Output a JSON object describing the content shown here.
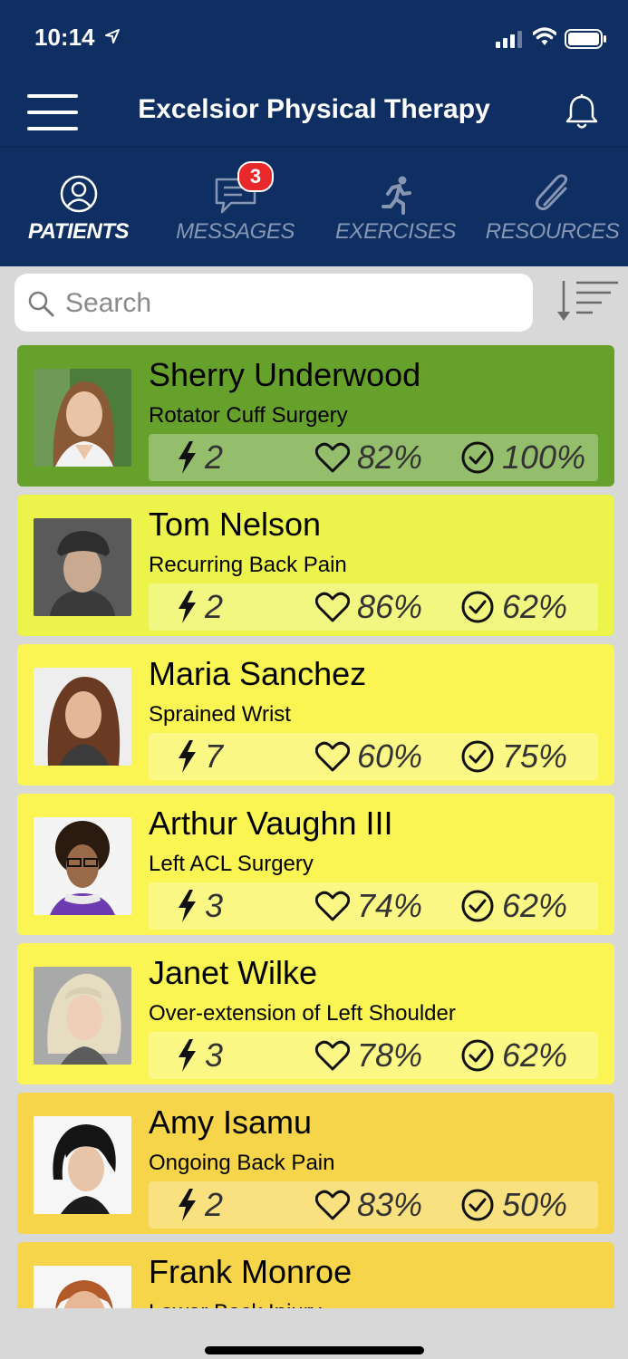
{
  "status_bar": {
    "time": "10:14"
  },
  "header": {
    "title": "Excelsior Physical Therapy"
  },
  "tabs": [
    {
      "label": "PATIENTS",
      "icon": "person-circle-icon",
      "active": true
    },
    {
      "label": "MESSAGES",
      "icon": "chat-bubble-icon",
      "active": false,
      "badge": "3"
    },
    {
      "label": "EXERCISES",
      "icon": "running-person-icon",
      "active": false
    },
    {
      "label": "RESOURCES",
      "icon": "paperclip-icon",
      "active": false
    }
  ],
  "search": {
    "placeholder": "Search",
    "value": ""
  },
  "colors": {
    "header_bg": "#0f2f62",
    "badge": "#e8282b",
    "card_green": "#66a22b",
    "card_lime": "#ecf44c",
    "card_yellow": "#faf552",
    "card_gold": "#f7d54a"
  },
  "patients": [
    {
      "name": "Sherry Underwood",
      "condition": "Rotator Cuff Surgery",
      "bolts": "2",
      "heart": "82%",
      "check": "100%",
      "color": "#66a22b"
    },
    {
      "name": "Tom Nelson",
      "condition": "Recurring Back Pain",
      "bolts": "2",
      "heart": "86%",
      "check": "62%",
      "color": "#ecf44c"
    },
    {
      "name": "Maria Sanchez",
      "condition": "Sprained Wrist",
      "bolts": "7",
      "heart": "60%",
      "check": "75%",
      "color": "#faf552"
    },
    {
      "name": "Arthur Vaughn III",
      "condition": "Left ACL Surgery",
      "bolts": "3",
      "heart": "74%",
      "check": "62%",
      "color": "#faf552"
    },
    {
      "name": "Janet Wilke",
      "condition": "Over-extension of Left Shoulder",
      "bolts": "3",
      "heart": "78%",
      "check": "62%",
      "color": "#faf552"
    },
    {
      "name": "Amy Isamu",
      "condition": "Ongoing Back Pain",
      "bolts": "2",
      "heart": "83%",
      "check": "50%",
      "color": "#f7d54a"
    },
    {
      "name": "Frank Monroe",
      "condition": "Lower Back Injury",
      "bolts": "",
      "heart": "",
      "check": "",
      "color": "#f7d54a"
    }
  ]
}
